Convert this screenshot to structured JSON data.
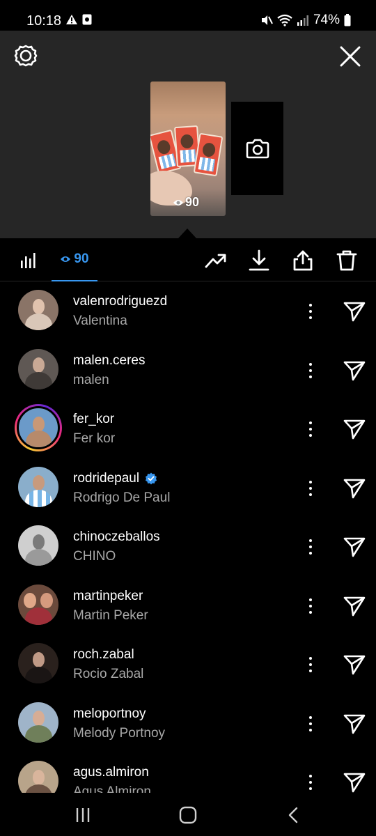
{
  "status_bar": {
    "time": "10:18",
    "battery": "74%"
  },
  "story": {
    "views_overlay": "90"
  },
  "toolbar": {
    "viewers_count": "90",
    "accent": "#3897f0"
  },
  "viewers": [
    {
      "username": "valenrodriguezd",
      "name": "Valentina",
      "verified": false,
      "story_ring": false
    },
    {
      "username": "malen.ceres",
      "name": "malen",
      "verified": false,
      "story_ring": false
    },
    {
      "username": "fer_kor",
      "name": "Fer kor",
      "verified": false,
      "story_ring": true
    },
    {
      "username": "rodridepaul",
      "name": "Rodrigo De Paul",
      "verified": true,
      "story_ring": false
    },
    {
      "username": "chinoczeballos",
      "name": "CHINO",
      "verified": false,
      "story_ring": false
    },
    {
      "username": "martinpeker",
      "name": "Martin Peker",
      "verified": false,
      "story_ring": false
    },
    {
      "username": "roch.zabal",
      "name": "Rocio Zabal",
      "verified": false,
      "story_ring": false
    },
    {
      "username": "meloportnoy",
      "name": "Melody Portnoy",
      "verified": false,
      "story_ring": false
    },
    {
      "username": "agus.almiron",
      "name": "Agus Almiron",
      "verified": false,
      "story_ring": false
    }
  ]
}
